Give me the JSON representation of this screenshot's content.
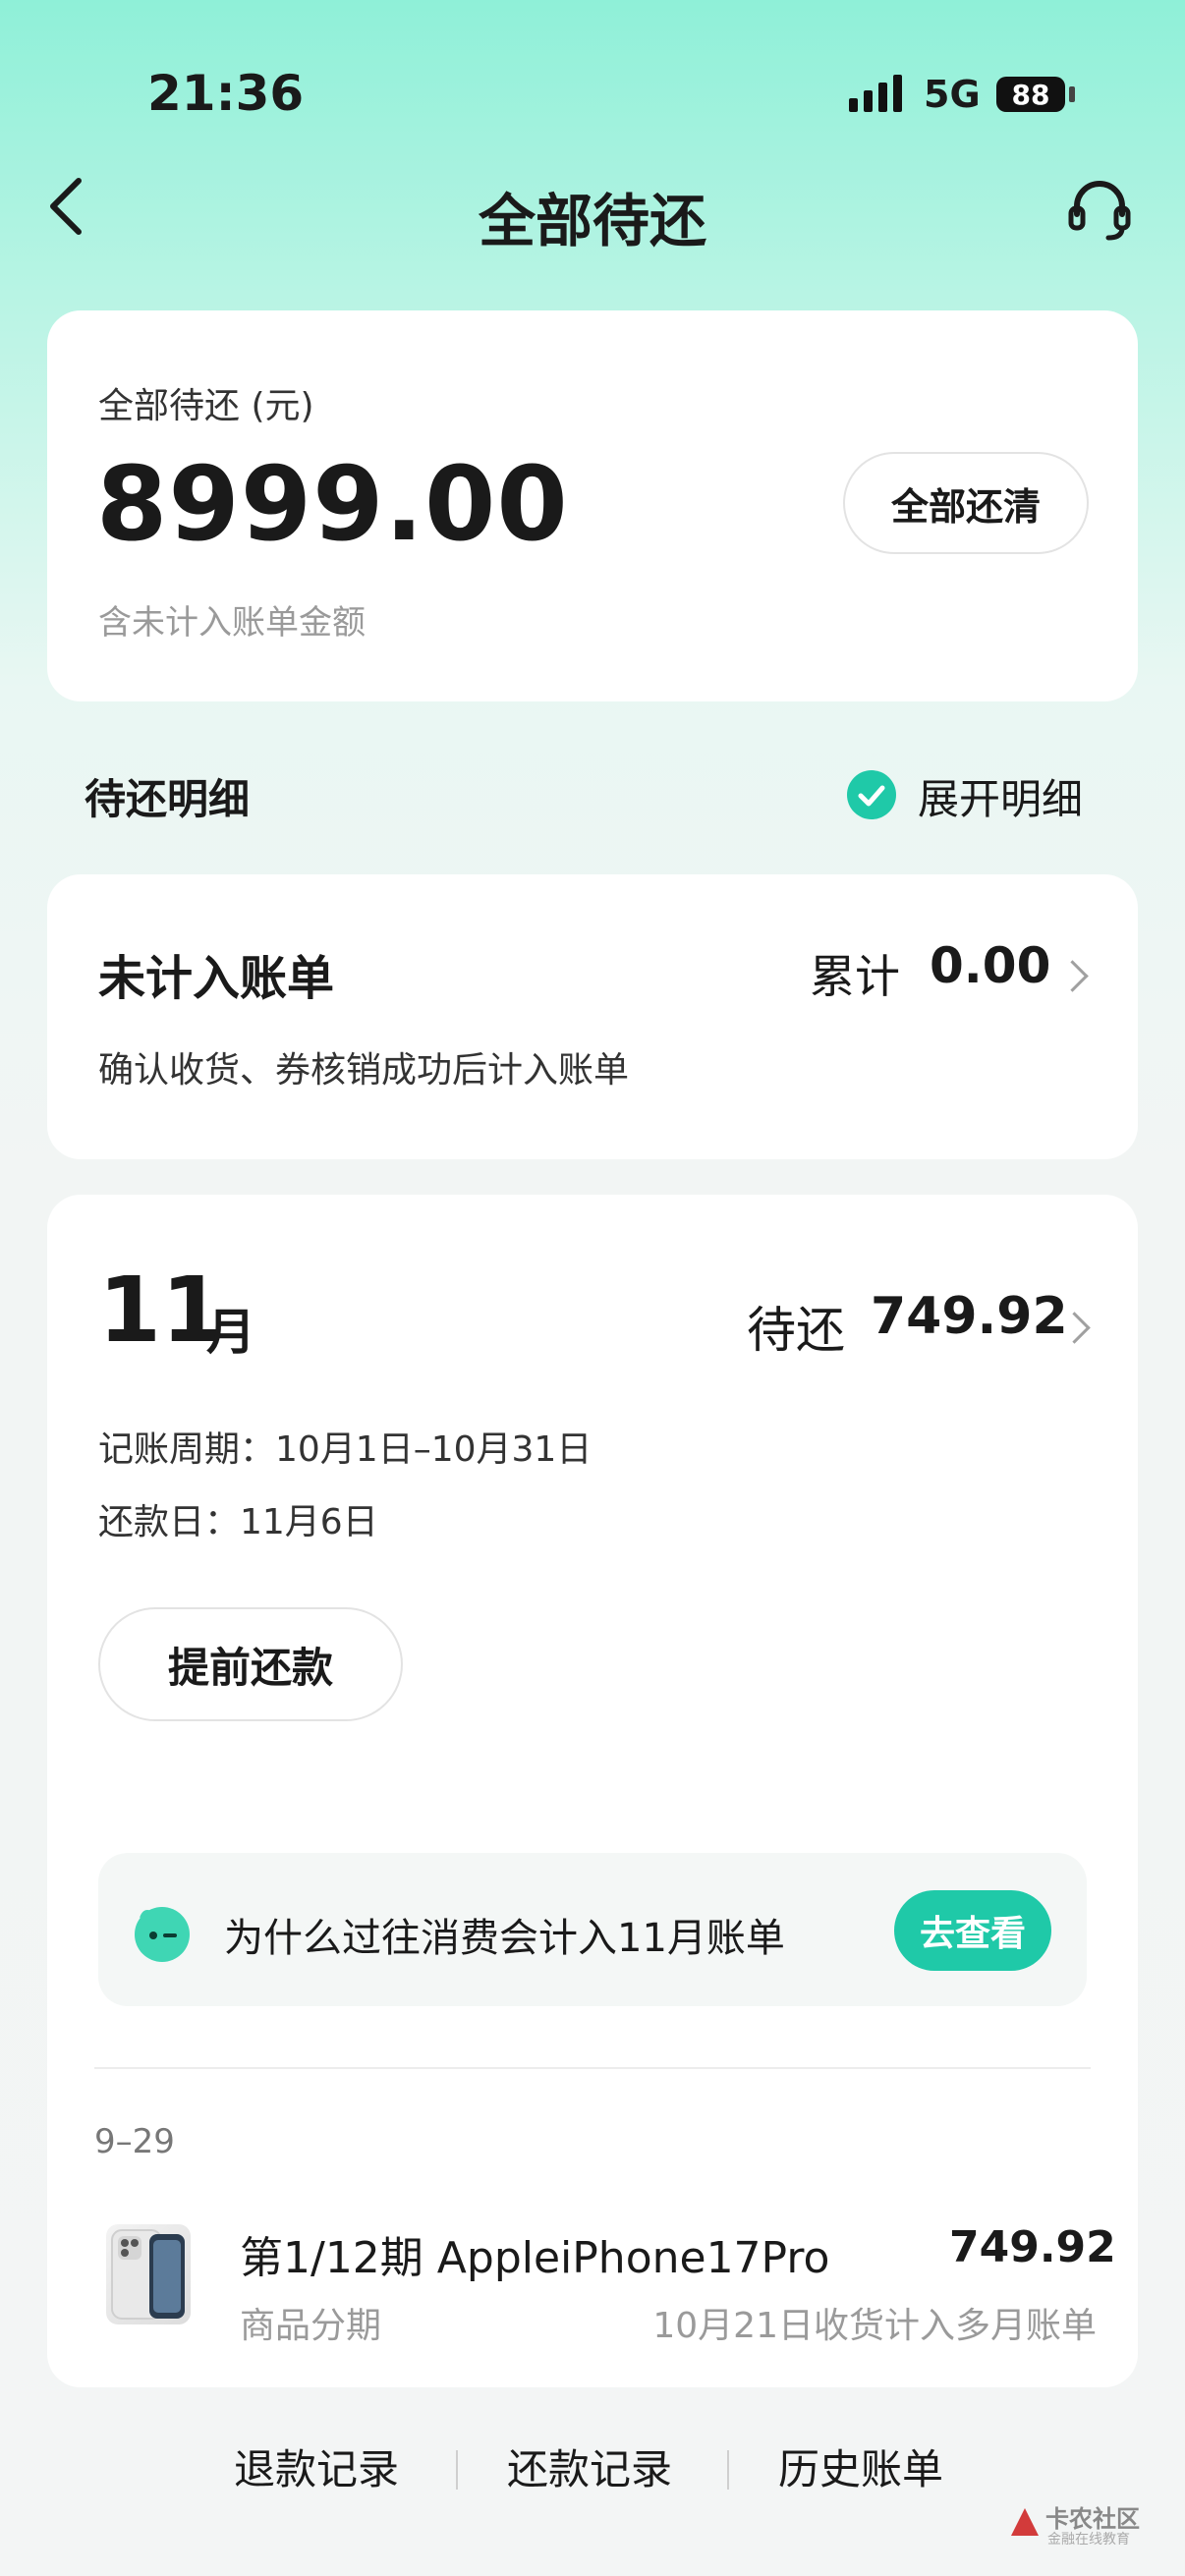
{
  "status_bar": {
    "time": "21:36",
    "network": "5G",
    "battery": "88"
  },
  "header": {
    "title": "全部待还"
  },
  "summary": {
    "label": "全部待还 (元)",
    "amount": "8999.00",
    "note": "含未计入账单金额",
    "pay_all_label": "全部还清"
  },
  "detail_section": {
    "title": "待还明细",
    "expand_label": "展开明细"
  },
  "unbilled": {
    "title": "未计入账单",
    "total_label": "累计",
    "total_value": "0.00",
    "desc": "确认收货、券核销成功后计入账单"
  },
  "bill": {
    "month_num": "11",
    "month_unit": "月",
    "due_label": "待还",
    "due_value": "749.92",
    "period": "记账周期：10月1日–10月31日",
    "due_date": "还款日：11月6日",
    "prepay_label": "提前还款",
    "tip_text": "为什么过往消费会计入11月账单",
    "tip_button": "去查看",
    "group_date": "9–29",
    "items": [
      {
        "title": "第1/12期 AppleiPhone17Pro",
        "amount": "749.92",
        "type": "商品分期",
        "note": "10月21日收货计入多月账单"
      }
    ]
  },
  "footer": {
    "links": [
      "退款记录",
      "还款记录",
      "历史账单"
    ]
  },
  "watermark": {
    "text": "卡农社区",
    "subtext": "金融在线教育"
  },
  "colors": {
    "accent": "#1fc9a8",
    "mint_top": "#8ff0d8"
  }
}
